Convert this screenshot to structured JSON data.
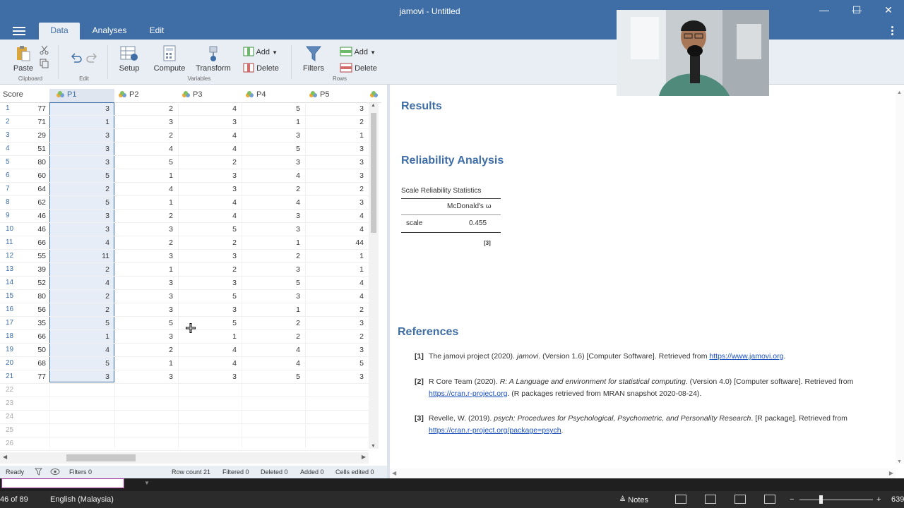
{
  "window": {
    "title": "jamovi - Untitled",
    "controls": {
      "minimize": "—",
      "maximize": "☐",
      "close": "✕"
    }
  },
  "ribbon_tabs": [
    {
      "label": "Data",
      "active": true
    },
    {
      "label": "Analyses",
      "active": false
    },
    {
      "label": "Edit",
      "active": false
    }
  ],
  "toolbar": {
    "paste": "Paste",
    "clipboard_group": "Clipboard",
    "edit_group": "Edit",
    "setup": "Setup",
    "compute": "Compute",
    "transform": "Transform",
    "variables_add": "Add",
    "variables_delete": "Delete",
    "variables_group": "Variables",
    "filters": "Filters",
    "rows_add": "Add",
    "rows_delete": "Delete",
    "rows_group": "Rows"
  },
  "sheet": {
    "columns": [
      "Score",
      "P1",
      "P2",
      "P3",
      "P4",
      "P5"
    ],
    "selected_column": "P1",
    "rows": [
      [
        77,
        3,
        2,
        4,
        5,
        3
      ],
      [
        71,
        1,
        3,
        3,
        1,
        2
      ],
      [
        29,
        3,
        2,
        4,
        3,
        1
      ],
      [
        51,
        3,
        4,
        4,
        5,
        3
      ],
      [
        80,
        3,
        5,
        2,
        3,
        3
      ],
      [
        60,
        5,
        1,
        3,
        4,
        3
      ],
      [
        64,
        2,
        4,
        3,
        2,
        2
      ],
      [
        62,
        5,
        1,
        4,
        4,
        3
      ],
      [
        46,
        3,
        2,
        4,
        3,
        4
      ],
      [
        46,
        3,
        3,
        5,
        3,
        4
      ],
      [
        66,
        4,
        2,
        2,
        1,
        44
      ],
      [
        55,
        11,
        3,
        3,
        2,
        1
      ],
      [
        39,
        2,
        1,
        2,
        3,
        1
      ],
      [
        52,
        4,
        3,
        3,
        5,
        4
      ],
      [
        80,
        2,
        3,
        5,
        3,
        4
      ],
      [
        56,
        2,
        3,
        3,
        1,
        2
      ],
      [
        35,
        5,
        5,
        5,
        2,
        3
      ],
      [
        66,
        1,
        3,
        1,
        2,
        2
      ],
      [
        50,
        4,
        2,
        4,
        4,
        3
      ],
      [
        68,
        5,
        1,
        4,
        4,
        5
      ],
      [
        77,
        3,
        3,
        3,
        5,
        3
      ]
    ],
    "empty_row_numbers": [
      22,
      23,
      24,
      25,
      26
    ]
  },
  "statusbar": {
    "ready": "Ready",
    "filters": "Filters 0",
    "row_count": "Row count 21",
    "filtered": "Filtered 0",
    "deleted": "Deleted 0",
    "added": "Added 0",
    "cells_edited": "Cells edited 0"
  },
  "results": {
    "heading": "Results",
    "analysis_title": "Reliability Analysis",
    "table_title": "Scale Reliability Statistics",
    "table_header": "McDonald's ω",
    "row_label": "scale",
    "row_value": "0.455",
    "footnote": "[3]",
    "references_heading": "References",
    "references": [
      {
        "num": "[1]",
        "pre": "The jamovi project (2020). ",
        "italic": "jamovi",
        "post": ". (Version 1.6) [Computer Software]. Retrieved from ",
        "link": "https://www.jamovi.org",
        "tail": "."
      },
      {
        "num": "[2]",
        "pre": "R Core Team (2020). ",
        "italic": "R: A Language and environment for statistical computing",
        "post": ". (Version 4.0) [Computer software]. Retrieved from ",
        "link": "https://cran.r-project.org",
        "tail": ". (R packages retrieved from MRAN snapshot 2020-08-24)."
      },
      {
        "num": "[3]",
        "pre": "Revelle, W. (2019). ",
        "italic": "psych: Procedures for Psychological, Psychometric, and Personality Research",
        "post": ". [R package]. Retrieved from ",
        "link": "https://cran.r-project.org/package=psych",
        "tail": "."
      }
    ]
  },
  "taskbar": {
    "page_info": "46 of 89",
    "language": "English (Malaysia)",
    "notes": "Notes",
    "zoom": "639"
  },
  "colors": {
    "accent": "#3e6ea5",
    "toolbar_bg": "#e9eef5",
    "link": "#1a4fbf"
  }
}
